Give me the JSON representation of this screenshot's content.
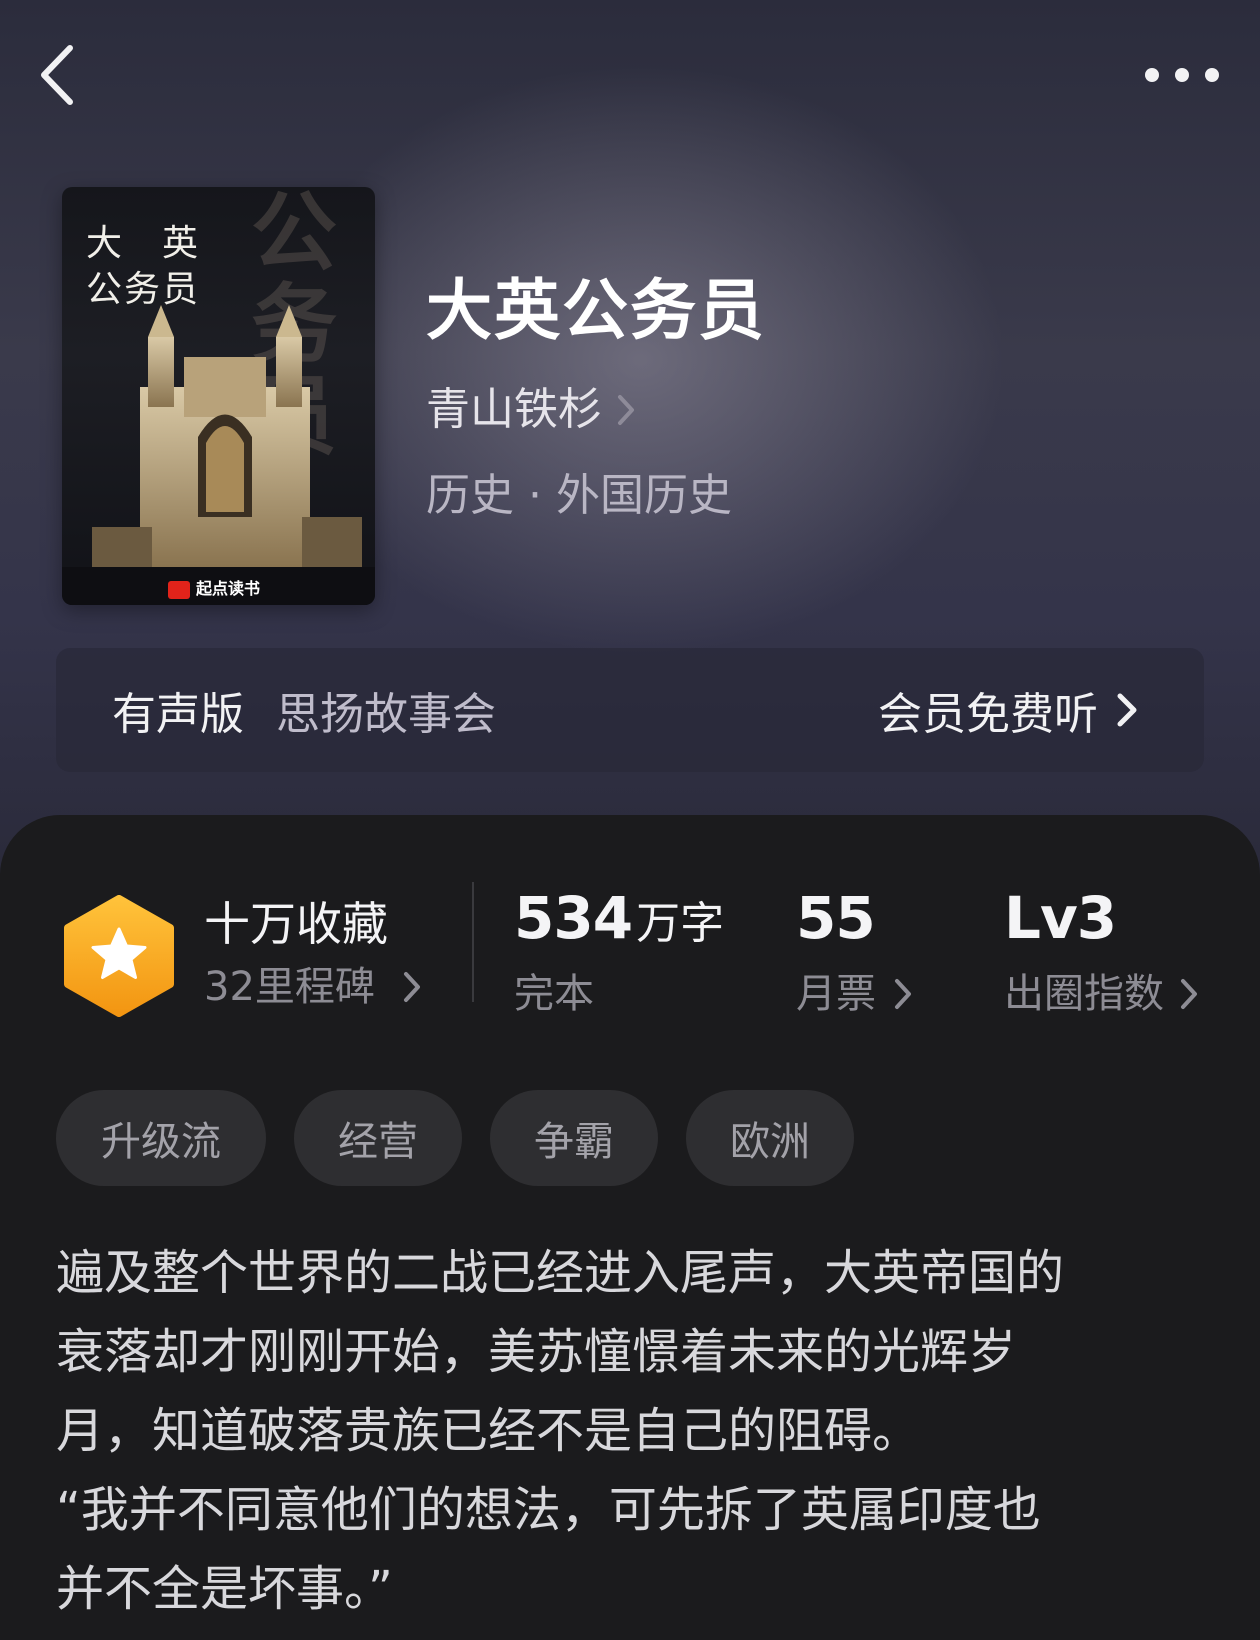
{
  "book": {
    "title": "大英公务员",
    "author": "青山铁杉",
    "genre": "历史 · 外国历史",
    "cover": {
      "title_line1": "大　英",
      "title_line2": "公务员",
      "background_text": "公务员",
      "brand": "起点读书"
    }
  },
  "audio": {
    "label": "有声版",
    "narrator": "思扬故事会",
    "cta": "会员免费听"
  },
  "stats": {
    "collect": {
      "title": "十万收藏",
      "sub": "32里程碑"
    },
    "words": {
      "value": "534",
      "unit": "万字",
      "sub": "完本"
    },
    "votes": {
      "value": "55",
      "sub": "月票"
    },
    "level": {
      "value": "Lv3",
      "sub": "出圈指数"
    }
  },
  "tags": [
    "升级流",
    "经营",
    "争霸",
    "欧洲"
  ],
  "synopsis": "遍及整个世界的二战已经进入尾声，大英帝国的\n衰落却才刚刚开始，美苏憧憬着未来的光辉岁\n月，知道破落贵族已经不是自己的阻碍。\n“我并不同意他们的想法，可先拆了英属印度也\n并不全是坏事。”",
  "icons": {
    "back": "chevron-left-icon",
    "more": "more-dots-icon",
    "badge": "star-hexagon-icon",
    "arrow": "chevron-right-icon"
  },
  "colors": {
    "badge_orange": "#f7a41d",
    "panel_bg": "#1b1b1d",
    "tag_bg": "#2e2e31"
  }
}
